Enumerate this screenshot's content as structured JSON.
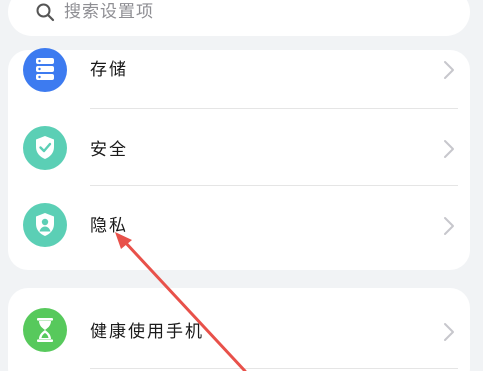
{
  "search": {
    "placeholder": "搜索设置项"
  },
  "settings_group_1": {
    "items": [
      {
        "label": "存储",
        "icon": "storage-icon",
        "icon_color": "#3d7bf0"
      },
      {
        "label": "安全",
        "icon": "shield-check-icon",
        "icon_color": "#5bcfb5"
      },
      {
        "label": "隐私",
        "icon": "privacy-person-shield-icon",
        "icon_color": "#5bcfb5"
      }
    ]
  },
  "settings_group_2": {
    "items": [
      {
        "label": "健康使用手机",
        "icon": "hourglass-icon",
        "icon_color": "#57c95c"
      }
    ]
  },
  "colors": {
    "background": "#f1f3f5",
    "card": "#ffffff",
    "annotation_arrow": "#e8514a",
    "chevron": "#c7c7cc"
  },
  "annotation": {
    "type": "arrow",
    "points_to": "隐私"
  }
}
